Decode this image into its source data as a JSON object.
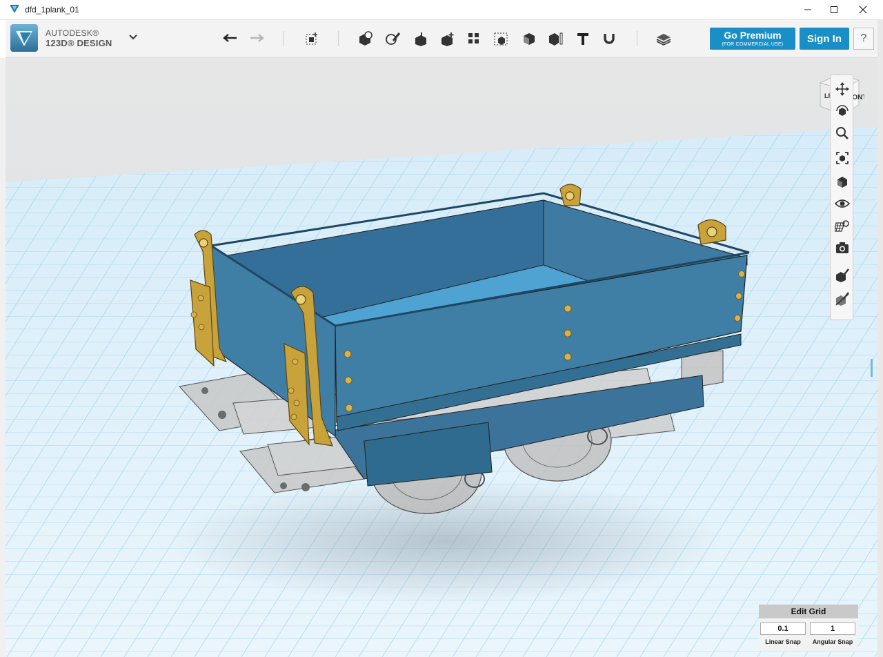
{
  "window": {
    "title": "dfd_1plank_01"
  },
  "brand": {
    "line1": "AUTODESK®",
    "line2": "123D® DESIGN"
  },
  "toolbar": {
    "tools": [
      {
        "name": "undo",
        "icon": "undo-arrow-icon"
      },
      {
        "name": "redo",
        "icon": "redo-arrow-icon"
      },
      {
        "name": "transform",
        "icon": "transform-box-icon"
      },
      {
        "name": "primitives",
        "icon": "primitive-shapes-icon"
      },
      {
        "name": "sketch",
        "icon": "sketch-pencil-icon"
      },
      {
        "name": "construct",
        "icon": "construct-icon"
      },
      {
        "name": "modify",
        "icon": "modify-icon"
      },
      {
        "name": "pattern",
        "icon": "pattern-grid-icon"
      },
      {
        "name": "grouping",
        "icon": "group-icon"
      },
      {
        "name": "combine",
        "icon": "combine-icon"
      },
      {
        "name": "measure",
        "icon": "measure-icon"
      },
      {
        "name": "text",
        "icon": "text-t-icon"
      },
      {
        "name": "snap",
        "icon": "magnet-snap-icon"
      },
      {
        "name": "materials",
        "icon": "layers-icon"
      }
    ]
  },
  "buttons": {
    "go_premium": "Go Premium",
    "go_premium_sub": "(FOR COMMERCIAL USE)",
    "sign_in": "Sign In",
    "help": "?"
  },
  "view_cube": {
    "left": "LFT",
    "front": "FRONT"
  },
  "nav_tools": [
    {
      "name": "pan",
      "icon": "pan-arrows-icon"
    },
    {
      "name": "orbit",
      "icon": "orbit-icon"
    },
    {
      "name": "zoom",
      "icon": "zoom-magnifier-icon"
    },
    {
      "name": "fit",
      "icon": "fit-view-icon"
    },
    {
      "name": "views",
      "icon": "view-cube-small-icon"
    },
    {
      "name": "visibility",
      "icon": "eye-icon"
    },
    {
      "name": "material",
      "icon": "material-grid-icon"
    },
    {
      "name": "screenshot",
      "icon": "camera-icon"
    },
    {
      "name": "show-solids",
      "icon": "show-solids-icon"
    },
    {
      "name": "hide-solids",
      "icon": "hide-solids-icon"
    }
  ],
  "edit_grid": {
    "title": "Edit Grid",
    "linear_snap_value": "0.1",
    "angular_snap_value": "1",
    "linear_snap_label": "Linear Snap",
    "angular_snap_label": "Angular Snap"
  },
  "colors": {
    "accent": "#1a8fc7",
    "wagon_body": "#3f7fa6",
    "brass": "#c8a23a",
    "grid_line": "#9fd0ea"
  }
}
